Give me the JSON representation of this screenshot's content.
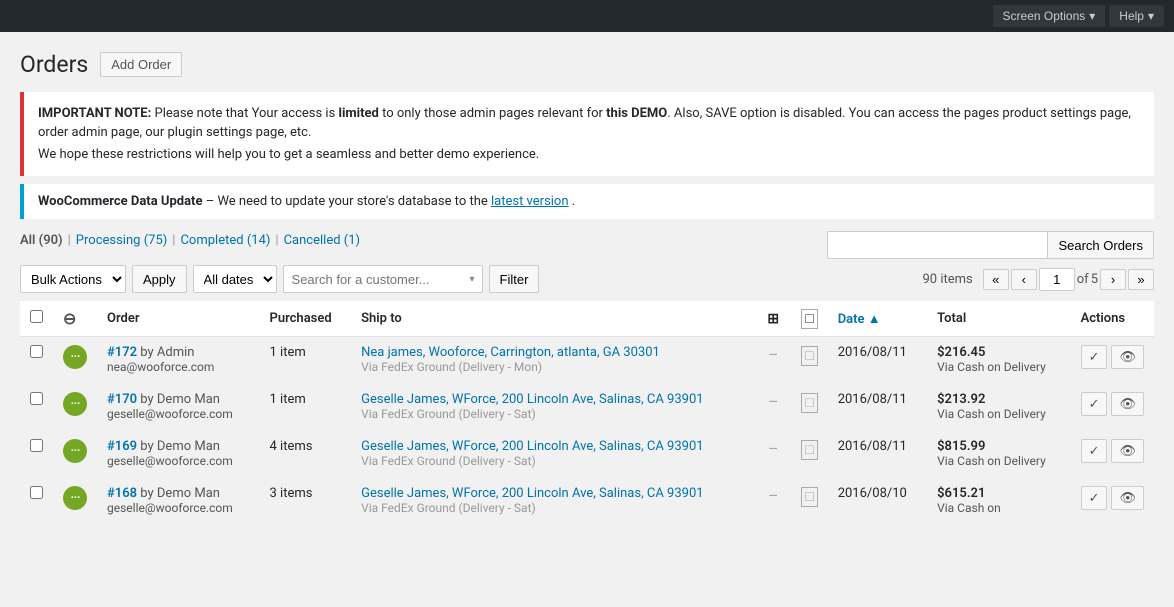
{
  "topbar": {
    "screen_options": "Screen Options",
    "help": "Help"
  },
  "page": {
    "title": "Orders",
    "add_order_label": "Add Order"
  },
  "notices": {
    "error_text": "IMPORTANT NOTE: Please note that Your access is limited to only those admin pages relevant for this DEMO. Also, SAVE option is disabled. You can access the pages product settings page, order admin page, our plugin settings page, etc.",
    "error_text2": "We hope these restrictions will help you to get a seamless and better demo experience.",
    "info_prefix": "WooCommerce Data Update",
    "info_text": " – We need to update your store's database to the ",
    "info_link": "latest version",
    "info_period": "."
  },
  "filter_tabs": [
    {
      "label": "All",
      "count": "(90)",
      "id": "all",
      "active": true
    },
    {
      "label": "Processing",
      "count": "(75)",
      "id": "processing"
    },
    {
      "label": "Completed",
      "count": "(14)",
      "id": "completed"
    },
    {
      "label": "Cancelled",
      "count": "(1)",
      "id": "cancelled"
    }
  ],
  "tablenav": {
    "bulk_actions_label": "Bulk Actions",
    "apply_label": "Apply",
    "all_dates_label": "All dates",
    "search_placeholder": "Search for a customer...",
    "filter_label": "Filter",
    "search_orders_label": "Search Orders",
    "items_count": "90 items",
    "current_page": "1",
    "total_pages": "5",
    "first_btn": "«",
    "prev_btn": "‹",
    "next_btn": "›",
    "last_btn": "»"
  },
  "table": {
    "headers": [
      "",
      "",
      "Order",
      "Purchased",
      "Ship to",
      "",
      "",
      "Date",
      "Total",
      "Actions"
    ],
    "date_sort": "Date ▲",
    "rows": [
      {
        "id": "172",
        "by": "Admin",
        "email": "nea@wooforce.com",
        "purchased": "1 item",
        "ship_name": "Nea james, Wooforce, Carrington, atlanta, GA 30301",
        "ship_via": "Via FedEx Ground (Delivery - Mon)",
        "date": "2016/08/11",
        "total": "$216.45",
        "total_via": "Via Cash on Delivery",
        "status_class": "status-processing"
      },
      {
        "id": "170",
        "by": "Demo Man",
        "email": "geselle@wooforce.com",
        "purchased": "1 item",
        "ship_name": "Geselle James, WForce, 200 Lincoln Ave, Salinas, CA 93901",
        "ship_via": "Via FedEx Ground (Delivery - Sat)",
        "date": "2016/08/11",
        "total": "$213.92",
        "total_via": "Via Cash on Delivery",
        "status_class": "status-processing"
      },
      {
        "id": "169",
        "by": "Demo Man",
        "email": "geselle@wooforce.com",
        "purchased": "4 items",
        "ship_name": "Geselle James, WForce, 200 Lincoln Ave, Salinas, CA 93901",
        "ship_via": "Via FedEx Ground (Delivery - Sat)",
        "date": "2016/08/11",
        "total": "$815.99",
        "total_via": "Via Cash on Delivery",
        "status_class": "status-processing"
      },
      {
        "id": "168",
        "by": "Demo Man",
        "email": "geselle@wooforce.com",
        "purchased": "3 items",
        "ship_name": "Geselle James, WForce, 200 Lincoln Ave, Salinas, CA 93901",
        "ship_via": "Via FedEx Ground (Delivery - Sat)",
        "date": "2016/08/10",
        "total": "$615.21",
        "total_via": "Via Cash on",
        "status_class": "status-processing"
      }
    ]
  }
}
